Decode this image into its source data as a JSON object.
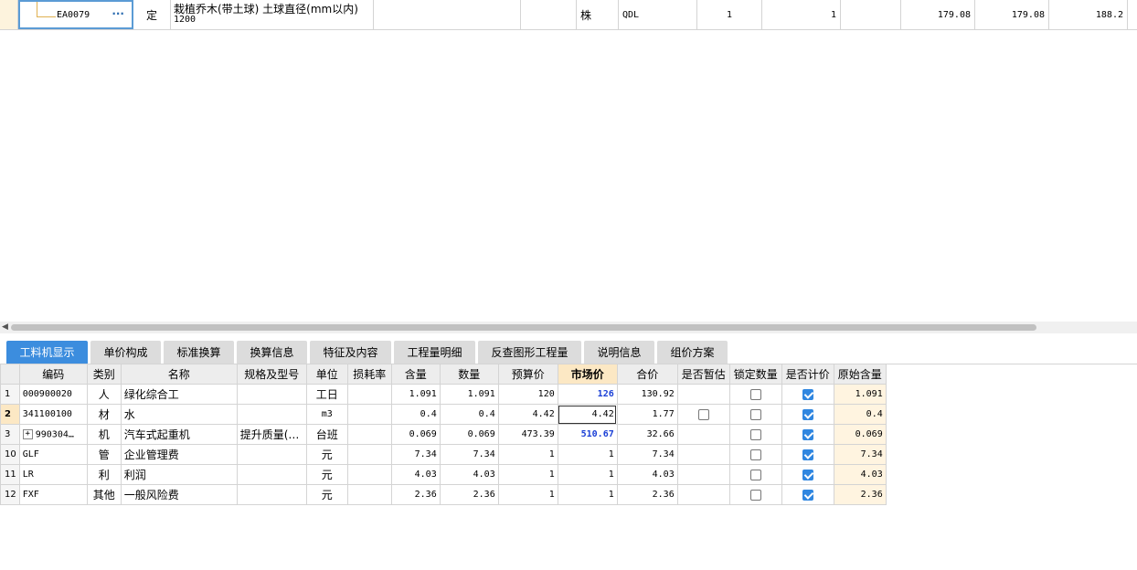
{
  "top_row": {
    "code": "EA0079",
    "dots": "···",
    "type": "定",
    "name_line1": "栽植乔木(带土球) 土球直径(mm以内)",
    "name_line2": "1200",
    "unit": "株",
    "expr": "QDL",
    "qty1": "1",
    "qty2": "1",
    "price1": "179.08",
    "price2": "179.08",
    "price3": "188.2"
  },
  "tabs": [
    {
      "label": "工料机显示"
    },
    {
      "label": "单价构成"
    },
    {
      "label": "标准换算"
    },
    {
      "label": "换算信息"
    },
    {
      "label": "特征及内容"
    },
    {
      "label": "工程量明细"
    },
    {
      "label": "反查图形工程量"
    },
    {
      "label": "说明信息"
    },
    {
      "label": "组价方案"
    }
  ],
  "columns": {
    "code": "编码",
    "category": "类别",
    "name": "名称",
    "spec": "规格及型号",
    "unit": "单位",
    "loss": "损耗率",
    "content": "含量",
    "quantity": "数量",
    "budget": "预算价",
    "market": "市场价",
    "total": "合价",
    "estimate": "是否暂估",
    "lock": "锁定数量",
    "priced": "是否计价",
    "original": "原始含量"
  },
  "rows": [
    {
      "no": "1",
      "code": "000900020",
      "category": "人",
      "name": "绿化综合工",
      "spec": "",
      "unit": "工日",
      "loss": "",
      "content": "1.091",
      "quantity": "1.091",
      "budget": "120",
      "market": "126",
      "total": "130.92",
      "original": "1.091"
    },
    {
      "no": "2",
      "code": "341100100",
      "category": "材",
      "name": "水",
      "spec": "",
      "unit": "m3",
      "loss": "",
      "content": "0.4",
      "quantity": "0.4",
      "budget": "4.42",
      "market": "4.42",
      "total": "1.77",
      "original": "0.4"
    },
    {
      "no": "3",
      "code": "990304…",
      "category": "机",
      "name": "汽车式起重机",
      "spec": "提升质量(…",
      "unit": "台班",
      "loss": "",
      "content": "0.069",
      "quantity": "0.069",
      "budget": "473.39",
      "market": "510.67",
      "total": "32.66",
      "original": "0.069"
    },
    {
      "no": "10",
      "code": "GLF",
      "category": "管",
      "name": "企业管理费",
      "spec": "",
      "unit": "元",
      "loss": "",
      "content": "7.34",
      "quantity": "7.34",
      "budget": "1",
      "market": "1",
      "total": "7.34",
      "original": "7.34"
    },
    {
      "no": "11",
      "code": "LR",
      "category": "利",
      "name": "利润",
      "spec": "",
      "unit": "元",
      "loss": "",
      "content": "4.03",
      "quantity": "4.03",
      "budget": "1",
      "market": "1",
      "total": "4.03",
      "original": "4.03"
    },
    {
      "no": "12",
      "code": "FXF",
      "category": "其他",
      "name": "一般风险费",
      "spec": "",
      "unit": "元",
      "loss": "",
      "content": "2.36",
      "quantity": "2.36",
      "budget": "1",
      "market": "1",
      "total": "2.36",
      "original": "2.36"
    }
  ],
  "colors": {
    "accent": "#3c8dde",
    "highlight_text": "#1a3fd6",
    "selected_header": "#fce8c4"
  }
}
